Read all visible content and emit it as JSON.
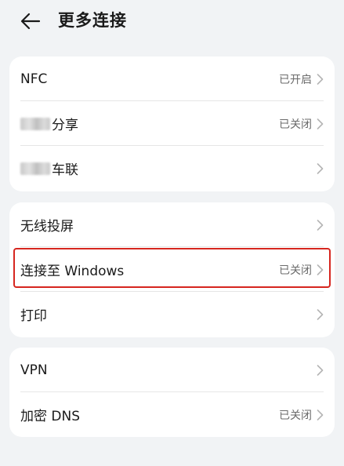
{
  "header": {
    "title": "更多连接"
  },
  "card1": {
    "nfc": {
      "label": "NFC",
      "status": "已开启"
    },
    "share": {
      "label": "分享",
      "status": "已关闭"
    },
    "car": {
      "label": "车联",
      "status": ""
    }
  },
  "card2": {
    "cast": {
      "label": "无线投屏",
      "status": ""
    },
    "windows": {
      "label": "连接至 Windows",
      "status": "已关闭"
    },
    "print": {
      "label": "打印",
      "status": ""
    }
  },
  "card3": {
    "vpn": {
      "label": "VPN",
      "status": ""
    },
    "dns": {
      "label": "加密 DNS",
      "status": "已关闭"
    }
  },
  "colors": {
    "highlight": "#d6261f",
    "background": "#f1f3f5",
    "card": "#ffffff"
  }
}
